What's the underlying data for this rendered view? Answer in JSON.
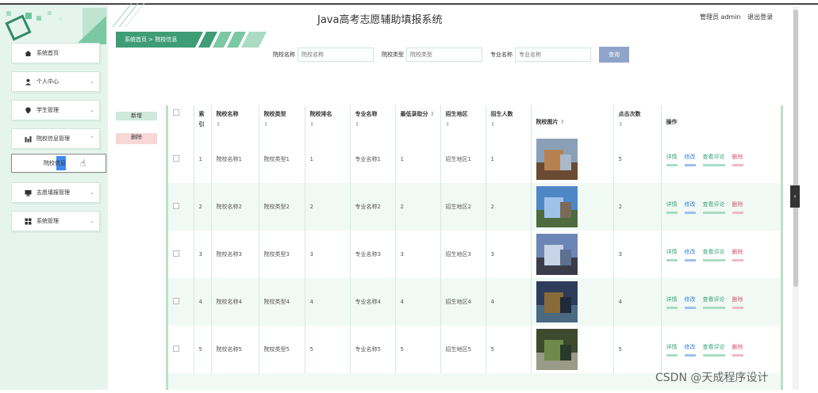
{
  "header": {
    "title": "Java高考志愿辅助填报系统",
    "user_role": "管理员 admin",
    "logout_label": "退出登录"
  },
  "sidebar": {
    "items": [
      {
        "label": "系统首页",
        "icon": "home-icon"
      },
      {
        "label": "个人中心",
        "icon": "user-icon"
      },
      {
        "label": "学生管理",
        "icon": "location-icon"
      },
      {
        "label": "院校信息管理",
        "icon": "bar-chart-icon"
      },
      {
        "label": "院校信息",
        "icon": ""
      },
      {
        "label": "志愿填报管理",
        "icon": "monitor-icon"
      },
      {
        "label": "系统管理",
        "icon": "grid-icon"
      }
    ]
  },
  "breadcrumb": {
    "home": "系统首页",
    "separator": ">",
    "current": "院校信息"
  },
  "search": {
    "fields": [
      {
        "label": "院校名称",
        "placeholder": "院校名称"
      },
      {
        "label": "院校类型",
        "placeholder": "院校类型"
      },
      {
        "label": "专业名称",
        "placeholder": "专业名称"
      }
    ],
    "button_label": "查询"
  },
  "actions": {
    "add_label": "新增",
    "delete_label": "删除"
  },
  "table": {
    "columns": [
      "索引",
      "院校名称",
      "院校类型",
      "院校排名",
      "专业名称",
      "最低录取分",
      "招生地区",
      "招生人数",
      "院校图片",
      "点击次数",
      "操作"
    ],
    "ops": [
      "详情",
      "修改",
      "查看评论",
      "删除"
    ],
    "rows": [
      {
        "index": "1",
        "name": "院校名称1",
        "type": "院校类型1",
        "rank": "1",
        "major": "专业名称1",
        "min_score": "1",
        "region": "招生地区1",
        "count": "1",
        "clicks": "5"
      },
      {
        "index": "2",
        "name": "院校名称2",
        "type": "院校类型2",
        "rank": "2",
        "major": "专业名称2",
        "min_score": "2",
        "region": "招生地区2",
        "count": "2",
        "clicks": "2"
      },
      {
        "index": "3",
        "name": "院校名称3",
        "type": "院校类型3",
        "rank": "3",
        "major": "专业名称3",
        "min_score": "3",
        "region": "招生地区3",
        "count": "3",
        "clicks": "3"
      },
      {
        "index": "4",
        "name": "院校名称4",
        "type": "院校类型4",
        "rank": "4",
        "major": "专业名称4",
        "min_score": "4",
        "region": "招生地区4",
        "count": "4",
        "clicks": "4"
      },
      {
        "index": "5",
        "name": "院校名称5",
        "type": "院校类型5",
        "rank": "5",
        "major": "专业名称5",
        "min_score": "5",
        "region": "招生地区5",
        "count": "5",
        "clicks": "5"
      }
    ]
  },
  "watermark": "CSDN @天成程序设计",
  "colors": {
    "sidebar_bg": "#e6f4ee",
    "accent_green": "#3aa37a",
    "banner_green": "#3f9d76",
    "query_button": "#8fa4c9"
  }
}
